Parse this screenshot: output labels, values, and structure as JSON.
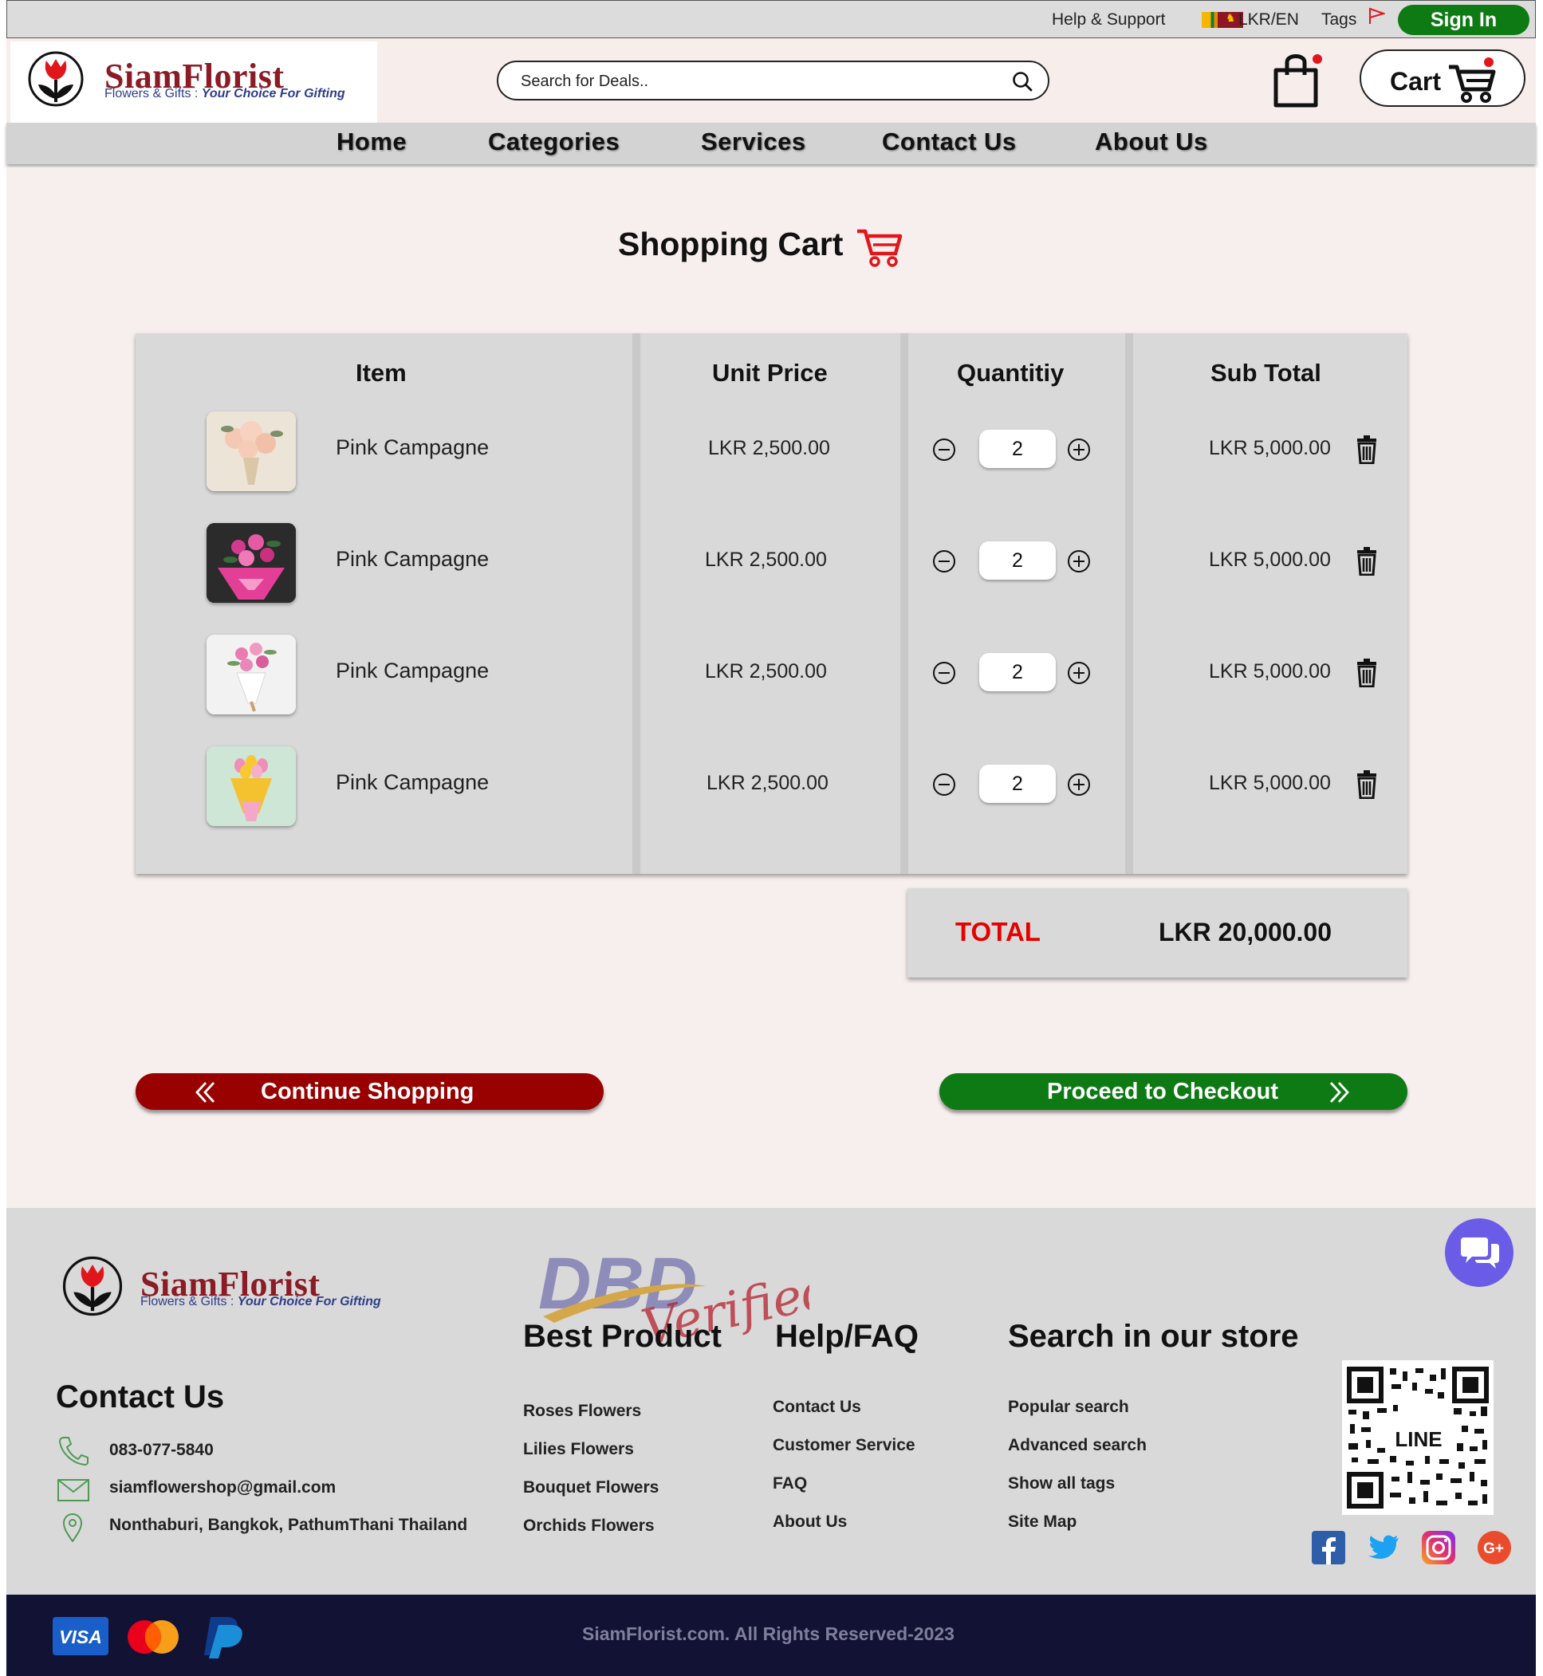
{
  "topbar": {
    "help_support": "Help & Support",
    "currency_lang": "LKR/EN",
    "tags": "Tags",
    "sign_in": "Sign In"
  },
  "brand": {
    "name": "SiamFlorist",
    "tagline_prefix": "Flowers & Gifts : ",
    "tagline_emph": "Your Choice For Gifting"
  },
  "header": {
    "search_placeholder": "Search for Deals..",
    "cart_label": "Cart"
  },
  "nav": {
    "items": [
      "Home",
      "Categories",
      "Services",
      "Contact Us",
      "About Us"
    ]
  },
  "cart": {
    "title": "Shopping Cart",
    "columns": [
      "Item",
      "Unit Price",
      "Quantitiy",
      "Sub Total"
    ],
    "rows": [
      {
        "name": "Pink Campagne",
        "unit_price": "LKR 2,500.00",
        "qty": "2",
        "subtotal": "LKR 5,000.00"
      },
      {
        "name": "Pink Campagne",
        "unit_price": "LKR 2,500.00",
        "qty": "2",
        "subtotal": "LKR 5,000.00"
      },
      {
        "name": "Pink Campagne",
        "unit_price": "LKR 2,500.00",
        "qty": "2",
        "subtotal": "LKR 5,000.00"
      },
      {
        "name": "Pink Campagne",
        "unit_price": "LKR 2,500.00",
        "qty": "2",
        "subtotal": "LKR 5,000.00"
      }
    ],
    "total_label": "TOTAL",
    "total_value": "LKR 20,000.00",
    "continue_label": "Continue Shopping",
    "checkout_label": "Proceed to Checkout"
  },
  "footer": {
    "contact_heading": "Contact Us",
    "phone": "083-077-5840",
    "email": "siamflowershop@gmail.com",
    "address": "Nonthaburi, Bangkok, PathumThani Thailand",
    "badge_text": "DBD",
    "badge_script": "Verified",
    "best_product": {
      "heading": "Best Product",
      "links": [
        "Roses Flowers",
        "Lilies Flowers",
        "Bouquet Flowers",
        "Orchids Flowers"
      ]
    },
    "help": {
      "heading": "Help/FAQ",
      "links": [
        "Contact Us",
        "Customer Service",
        "FAQ",
        "About Us"
      ]
    },
    "search_store": {
      "heading": "Search in our store",
      "links": [
        "Popular search",
        "Advanced search",
        "Show all tags",
        "Site Map"
      ]
    },
    "qr_label": "LINE",
    "social": [
      "facebook-icon",
      "twitter-icon",
      "instagram-icon",
      "google-plus-icon"
    ],
    "payments": [
      "VISA",
      "mastercard-icon",
      "paypal-icon"
    ],
    "copyright": "SiamFlorist.com. All Rights Reserved-2023"
  },
  "colors": {
    "brand_red": "#8b1b24",
    "sign_in_green": "#0e7a14",
    "continue_red": "#990000",
    "total_red": "#e60000",
    "footer_dark": "#121235",
    "chat_purple": "#6b5ce7"
  }
}
